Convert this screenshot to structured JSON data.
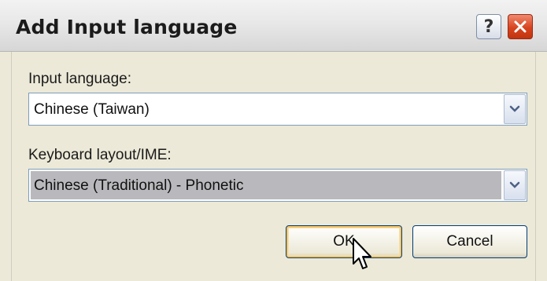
{
  "window": {
    "title": "Add Input language"
  },
  "titlebar_buttons": {
    "help_glyph": "?",
    "close_icon": "close-icon"
  },
  "input_language": {
    "label": "Input language:",
    "value": "Chinese (Taiwan)"
  },
  "keyboard_layout": {
    "label": "Keyboard layout/IME:",
    "value": "Chinese (Traditional) - Phonetic"
  },
  "buttons": {
    "ok_label": "OK",
    "cancel_label": "Cancel"
  },
  "colors": {
    "title_text": "#1b1b1b",
    "close_button": "#d8431f",
    "focus_ring": "#f6c56a",
    "selected_band": "#b9b9bd"
  }
}
